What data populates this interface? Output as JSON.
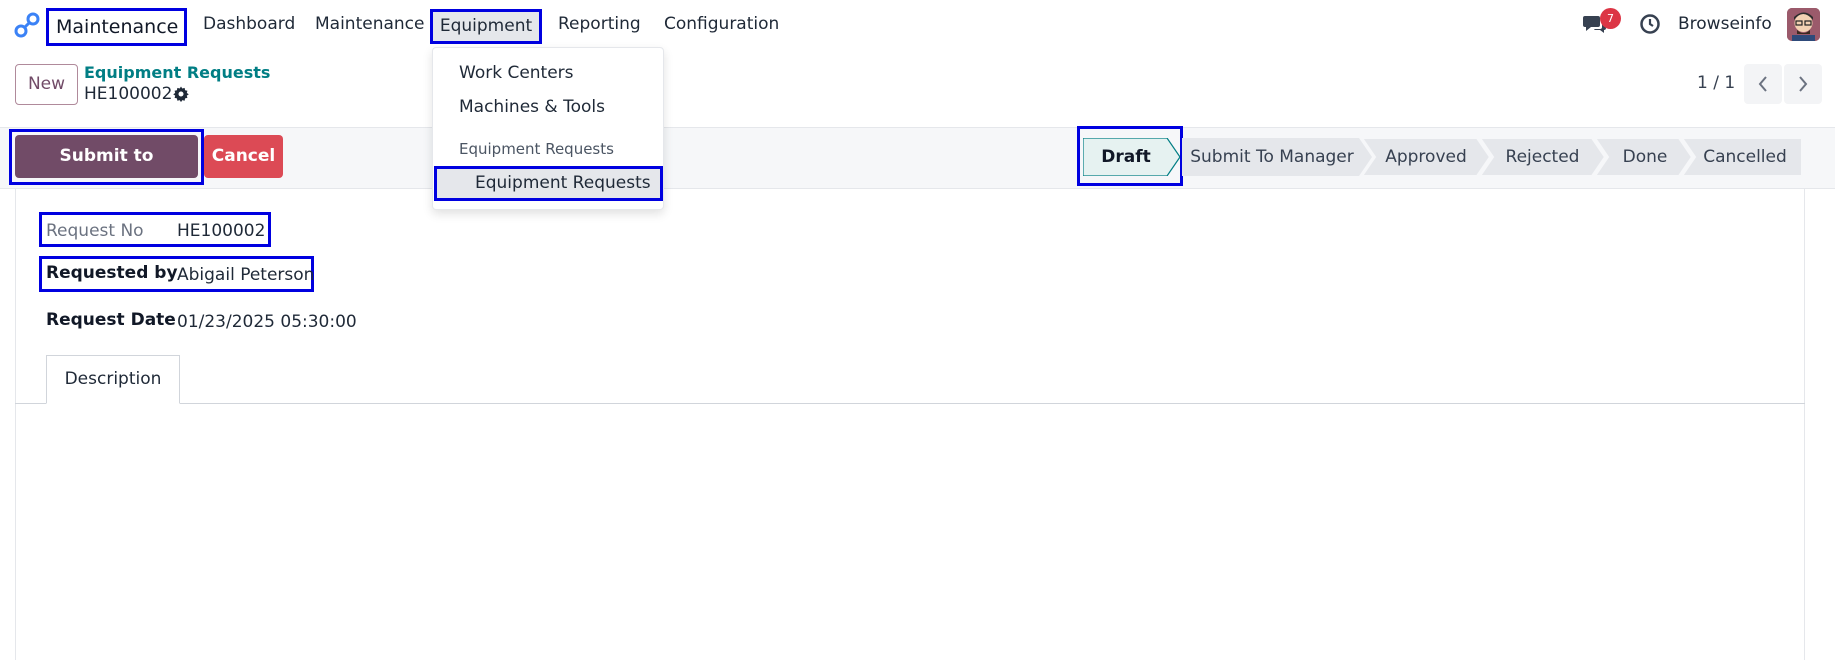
{
  "navbar": {
    "app_name": "Maintenance",
    "menus": [
      "Dashboard",
      "Maintenance",
      "Equipment",
      "Reporting",
      "Configuration"
    ],
    "notification_count": "7",
    "user_name": "Browseinfo"
  },
  "dropdown": {
    "items": [
      "Work Centers",
      "Machines & Tools"
    ],
    "section_header": "Equipment Requests",
    "selected_item": "Equipment Requests"
  },
  "control_panel": {
    "new_label": "New",
    "breadcrumb": "Equipment Requests",
    "record_name": "HE100002",
    "pager": "1 / 1"
  },
  "actions": {
    "submit_label": "Submit to Manager",
    "cancel_label": "Cancel"
  },
  "statusbar": {
    "stages": [
      "Draft",
      "Submit To Manager",
      "Approved",
      "Rejected",
      "Done",
      "Cancelled"
    ],
    "current": "Draft"
  },
  "form": {
    "request_no_label": "Request No",
    "request_no": "HE100002",
    "requested_by_label": "Requested by",
    "requested_by": "Abigail Peterson",
    "request_date_label": "Request Date",
    "request_date": "01/23/2025 05:30:00",
    "tab_description": "Description"
  },
  "colors": {
    "primary": "#714b67",
    "danger": "#dc4a55",
    "link": "#017e84",
    "highlight_border": "#0000e0"
  }
}
